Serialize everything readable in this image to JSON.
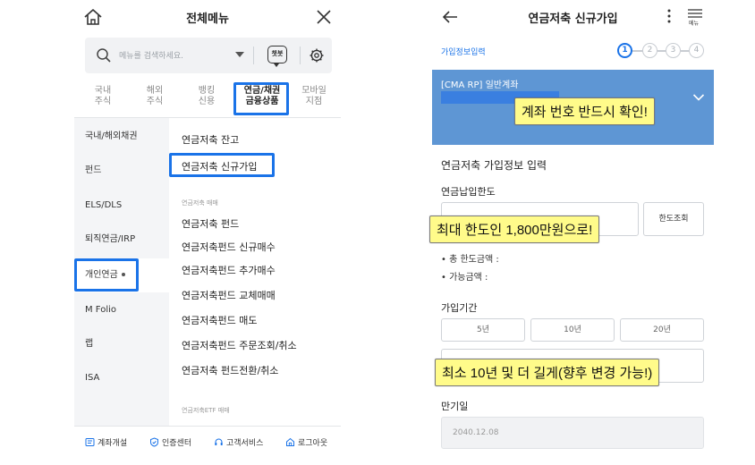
{
  "left": {
    "header": {
      "title": "전체메뉴",
      "home_icon": "home-icon",
      "close_icon": "close-icon"
    },
    "search": {
      "placeholder": "메뉴를 검색하세요.",
      "chatbot_label": "챗봇",
      "settings_icon": "gear-icon"
    },
    "category_tabs": [
      {
        "label_line1": "국내",
        "label_line2": "주식"
      },
      {
        "label_line1": "해외",
        "label_line2": "주식"
      },
      {
        "label_line1": "뱅킹",
        "label_line2": "신용"
      },
      {
        "label_line1": "연금/채권",
        "label_line2": "금융상품",
        "active": true
      },
      {
        "label_line1": "모바일",
        "label_line2": "지점"
      }
    ],
    "sidebar": [
      {
        "label": "국내/해외채권"
      },
      {
        "label": "펀드"
      },
      {
        "label": "ELS/DLS"
      },
      {
        "label": "퇴직연금/IRP"
      },
      {
        "label": "개인연금",
        "active": true
      },
      {
        "label": "M Folio"
      },
      {
        "label": "랩"
      },
      {
        "label": "ISA"
      }
    ],
    "menu": {
      "item_balance": "연금저축 잔고",
      "item_new": "연금저축 신규가입",
      "group_trade": "연금저축 매매",
      "trade_items": [
        "연금저축 펀드",
        "연금저축펀드 신규매수",
        "연금저축펀드 추가매수",
        "연금저축펀드 교체매매",
        "연금저축펀드 매도",
        "연금저축펀드 주문조회/취소",
        "연금저축 펀드전환/취소"
      ],
      "group_etf": "연금저축ETF 매매"
    },
    "footer": [
      {
        "label": "계좌개설",
        "icon": "account-icon"
      },
      {
        "label": "인증센터",
        "icon": "shield-icon"
      },
      {
        "label": "고객서비스",
        "icon": "headset-icon"
      },
      {
        "label": "로그아웃",
        "icon": "logout-icon"
      }
    ]
  },
  "right": {
    "header": {
      "title": "연금저축 신규가입",
      "menu_label": "메뉴"
    },
    "steps": {
      "label": "가입정보입력",
      "numbers": [
        "1",
        "2",
        "3",
        "4"
      ],
      "current": 1
    },
    "account": {
      "name": "[CMA RP] 일반계좌"
    },
    "section_title": "연금저축 가입정보 입력",
    "limit": {
      "label": "연금납입한도",
      "button": "한도조회",
      "bullet_total": "• 총 한도금액 :",
      "bullet_available": "• 가능금액 :"
    },
    "period": {
      "label": "가입기간",
      "options": [
        "5년",
        "10년",
        "20년"
      ]
    },
    "maturity": {
      "label": "만기일",
      "value": "2040.12.08"
    }
  },
  "callouts": {
    "account_check": "계좌 번호 반드시 확인!",
    "max_limit": "최대 한도인 1,800만원으로!",
    "min_period": "최소 10년 및 더 길게(향후 변경 가능!)"
  },
  "colors": {
    "highlight": "#1a73e8",
    "account_panel": "#5e96d4",
    "callout": "#fffb8a"
  }
}
